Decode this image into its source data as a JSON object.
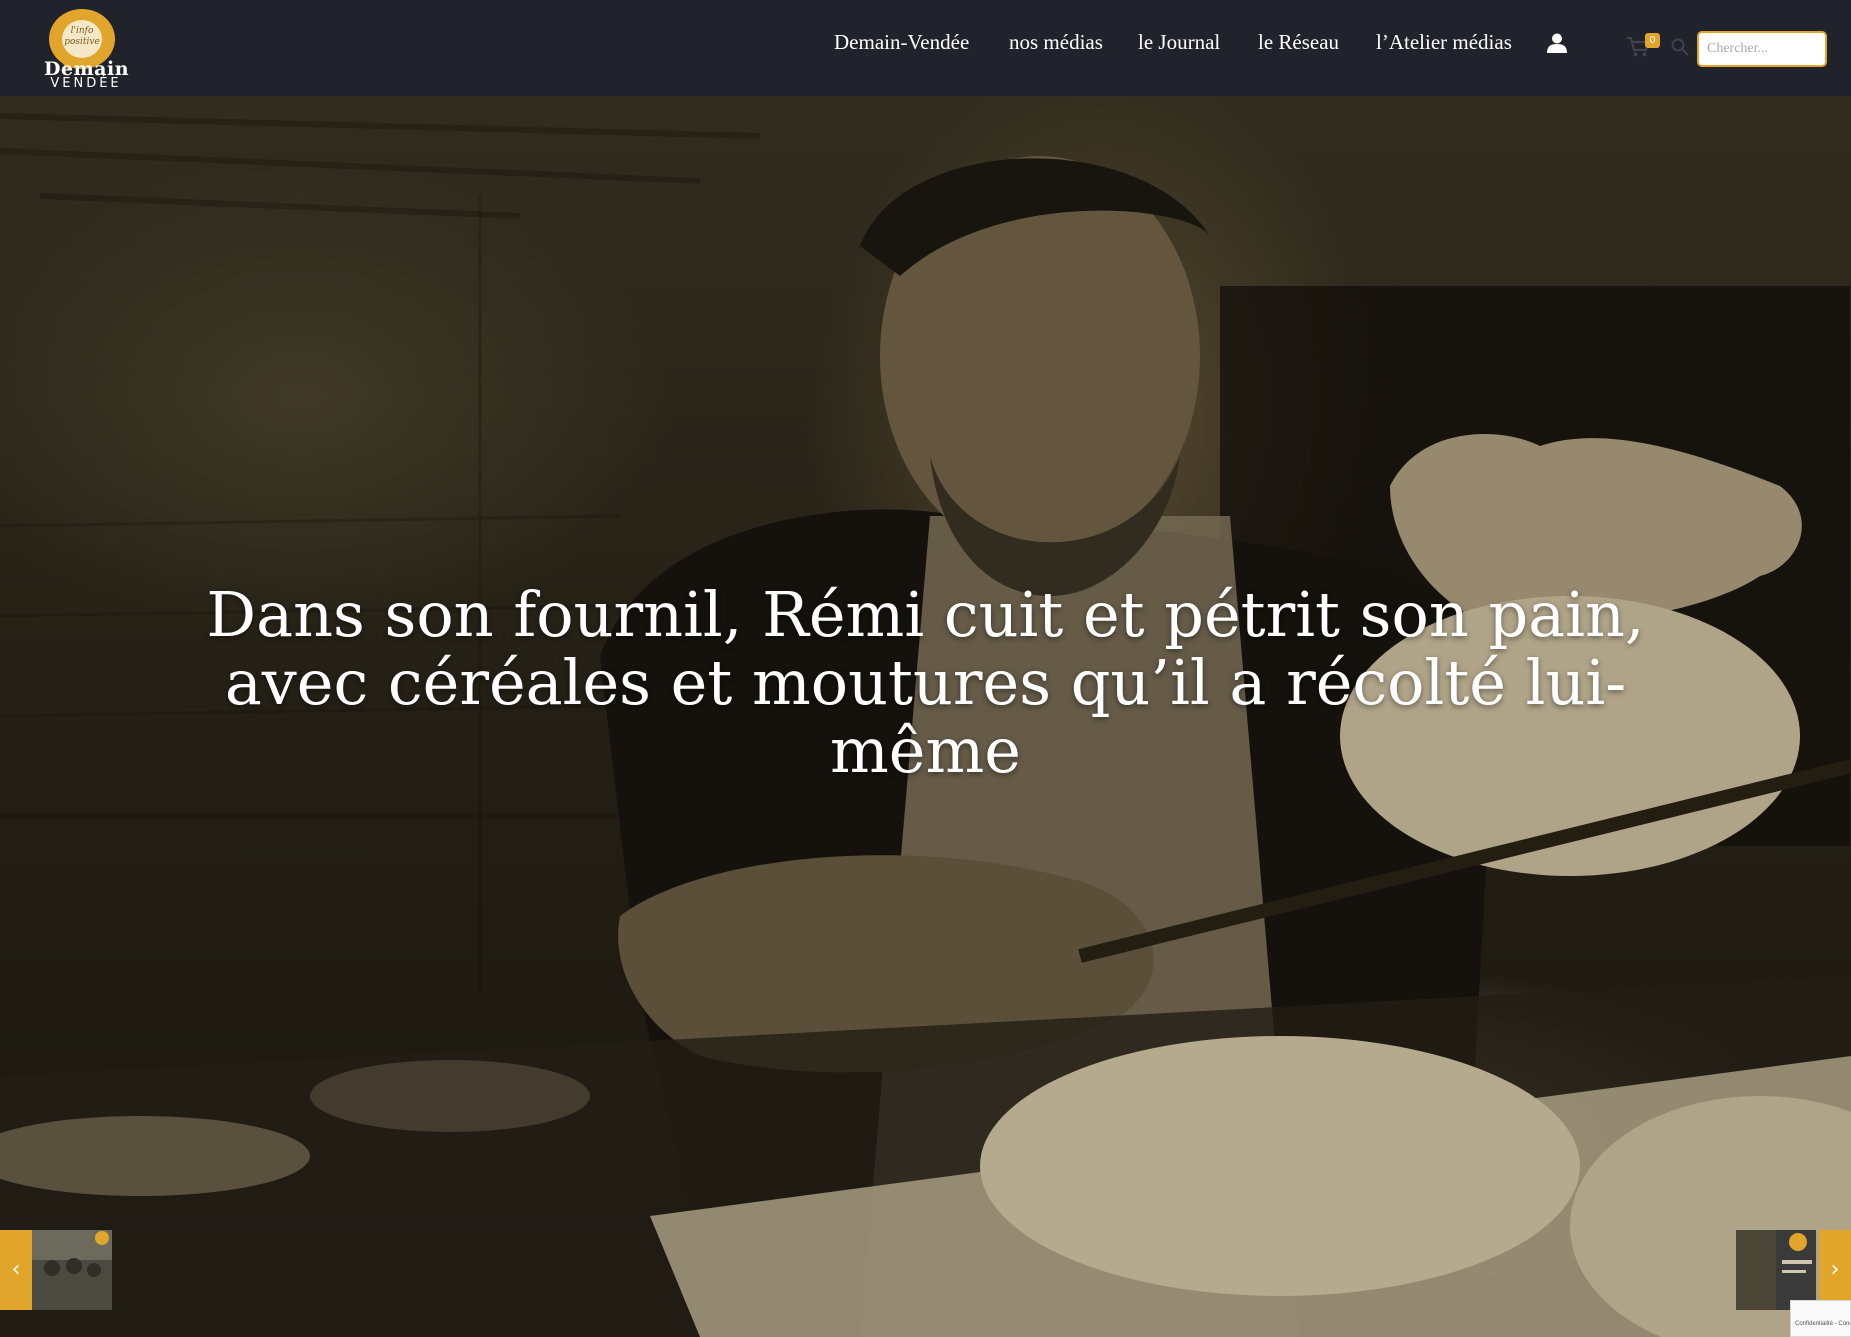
{
  "header": {
    "logo": {
      "tagline": "l'info positive",
      "word1": "Demain",
      "word2": "VENDÉE"
    },
    "nav": [
      {
        "label": "Demain-Vendée"
      },
      {
        "label": "nos médias"
      },
      {
        "label": "le Journal"
      },
      {
        "label": "le Réseau"
      },
      {
        "label": "l’Atelier médias"
      }
    ],
    "user_icon": "user-icon",
    "cart": {
      "icon": "cart-icon",
      "count": "0"
    },
    "search": {
      "icon": "search-icon",
      "placeholder": "Chercher..."
    }
  },
  "hero": {
    "title": "Dans son fournil, Rémi cuit et pétrit son pain, avec céréales et moutures qu’il a récolté lui-même",
    "prev": {
      "icon": "chevron-left-icon"
    },
    "next": {
      "icon": "chevron-right-icon"
    }
  },
  "recaptcha": {
    "text": "Confidentialité - Conditions"
  },
  "colors": {
    "header_bg": "#20232b",
    "accent": "#e0a52a",
    "text": "#ffffff"
  }
}
